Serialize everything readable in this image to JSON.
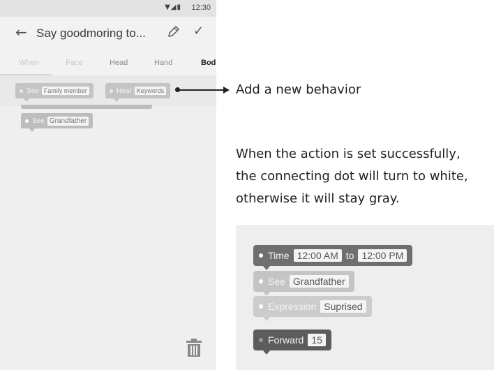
{
  "status_bar": {
    "time": "12:30",
    "icons": "▼◢▮"
  },
  "app_bar": {
    "title": "Say goodmoring to...",
    "back_icon": "arrow-left-icon",
    "edit_icon": "pencil-icon",
    "confirm_icon": "check-icon"
  },
  "tabs": [
    {
      "label": "When"
    },
    {
      "label": "Face"
    },
    {
      "label": "Head"
    },
    {
      "label": "Hand"
    },
    {
      "label": "Bod"
    }
  ],
  "phone_blocks": {
    "see1": {
      "keyword": "See",
      "value": "Family member"
    },
    "hear": {
      "keyword": "Hear",
      "value": "Keywords"
    },
    "see2": {
      "keyword": "See",
      "value": "Grandfather"
    }
  },
  "annotation": "Add a new behavior",
  "explanation": [
    "When the action is set successfully,",
    "the connecting dot will turn to white,",
    "otherwise it will stay gray."
  ],
  "example": {
    "time": {
      "keyword": "Time",
      "from": "12:00 AM",
      "to_word": "to",
      "to": "12:00 PM"
    },
    "see": {
      "keyword": "See",
      "value": "Grandfather"
    },
    "expression": {
      "keyword": "Expression",
      "value": "Suprised"
    },
    "forward": {
      "keyword": "Forward",
      "value": "15"
    }
  },
  "colors": {
    "dot_set": "#ffffff",
    "dot_unset": "#9a9a9a",
    "block_dark": "#6f6f6f",
    "block_light": "#c4c4c4"
  }
}
